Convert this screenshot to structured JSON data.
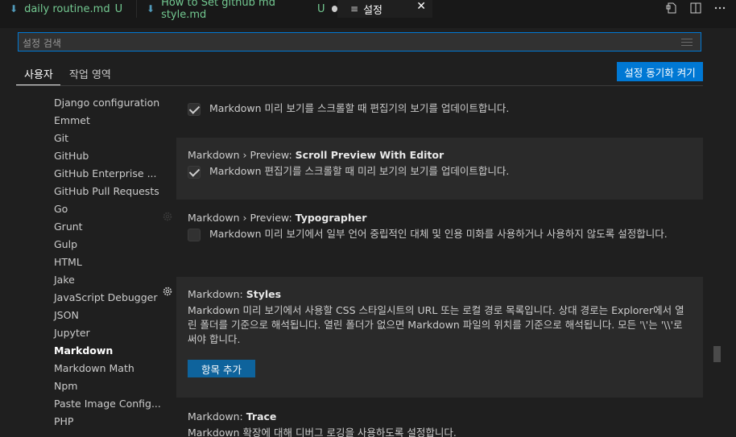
{
  "tabs": [
    {
      "label": "daily routine.md",
      "status": "U"
    },
    {
      "label": "How to Set github md style.md",
      "status": "U"
    },
    {
      "label": "설정"
    }
  ],
  "search": {
    "placeholder": "설정 검색"
  },
  "scope_tabs": {
    "user": "사용자",
    "workspace": "작업 영역"
  },
  "sync_button": "설정 동기화 켜기",
  "toc": [
    "Django configuration",
    "Emmet",
    "Git",
    "GitHub",
    "GitHub Enterprise ...",
    "GitHub Pull Requests",
    "Go",
    "Grunt",
    "Gulp",
    "HTML",
    "Jake",
    "JavaScript Debugger",
    "JSON",
    "Jupyter",
    "Markdown",
    "Markdown Math",
    "Npm",
    "Paste Image Config...",
    "PHP"
  ],
  "settings": {
    "s0": {
      "desc": "Markdown 미리 보기를 스크롤할 때 편집기의 보기를 업데이트합니다."
    },
    "s1": {
      "category": "Markdown › Preview: ",
      "name": "Scroll Preview With Editor",
      "desc": "Markdown 편집기를 스크롤할 때 미리 보기의 보기를 업데이트합니다."
    },
    "s2": {
      "category": "Markdown › Preview: ",
      "name": "Typographer",
      "desc": "Markdown 미리 보기에서 일부 언어 중립적인 대체 및 인용 미화를 사용하거나 사용하지 않도록 설정합니다."
    },
    "s3": {
      "category": "Markdown: ",
      "name": "Styles",
      "desc": "Markdown 미리 보기에서 사용할 CSS 스타일시트의 URL 또는 로컬 경로 목록입니다. 상대 경로는 Explorer에서 열린 폴더를 기준으로 해석됩니다. 열린 폴더가 없으면 Markdown 파일의 위치를 기준으로 해석됩니다. 모든 '\\'는 '\\\\'로 써야 합니다.",
      "button": "항목 추가"
    },
    "s4": {
      "category": "Markdown: ",
      "name": "Trace",
      "desc": "Markdown 확장에 대해 디버그 로깅을 사용하도록 설정합니다."
    }
  }
}
